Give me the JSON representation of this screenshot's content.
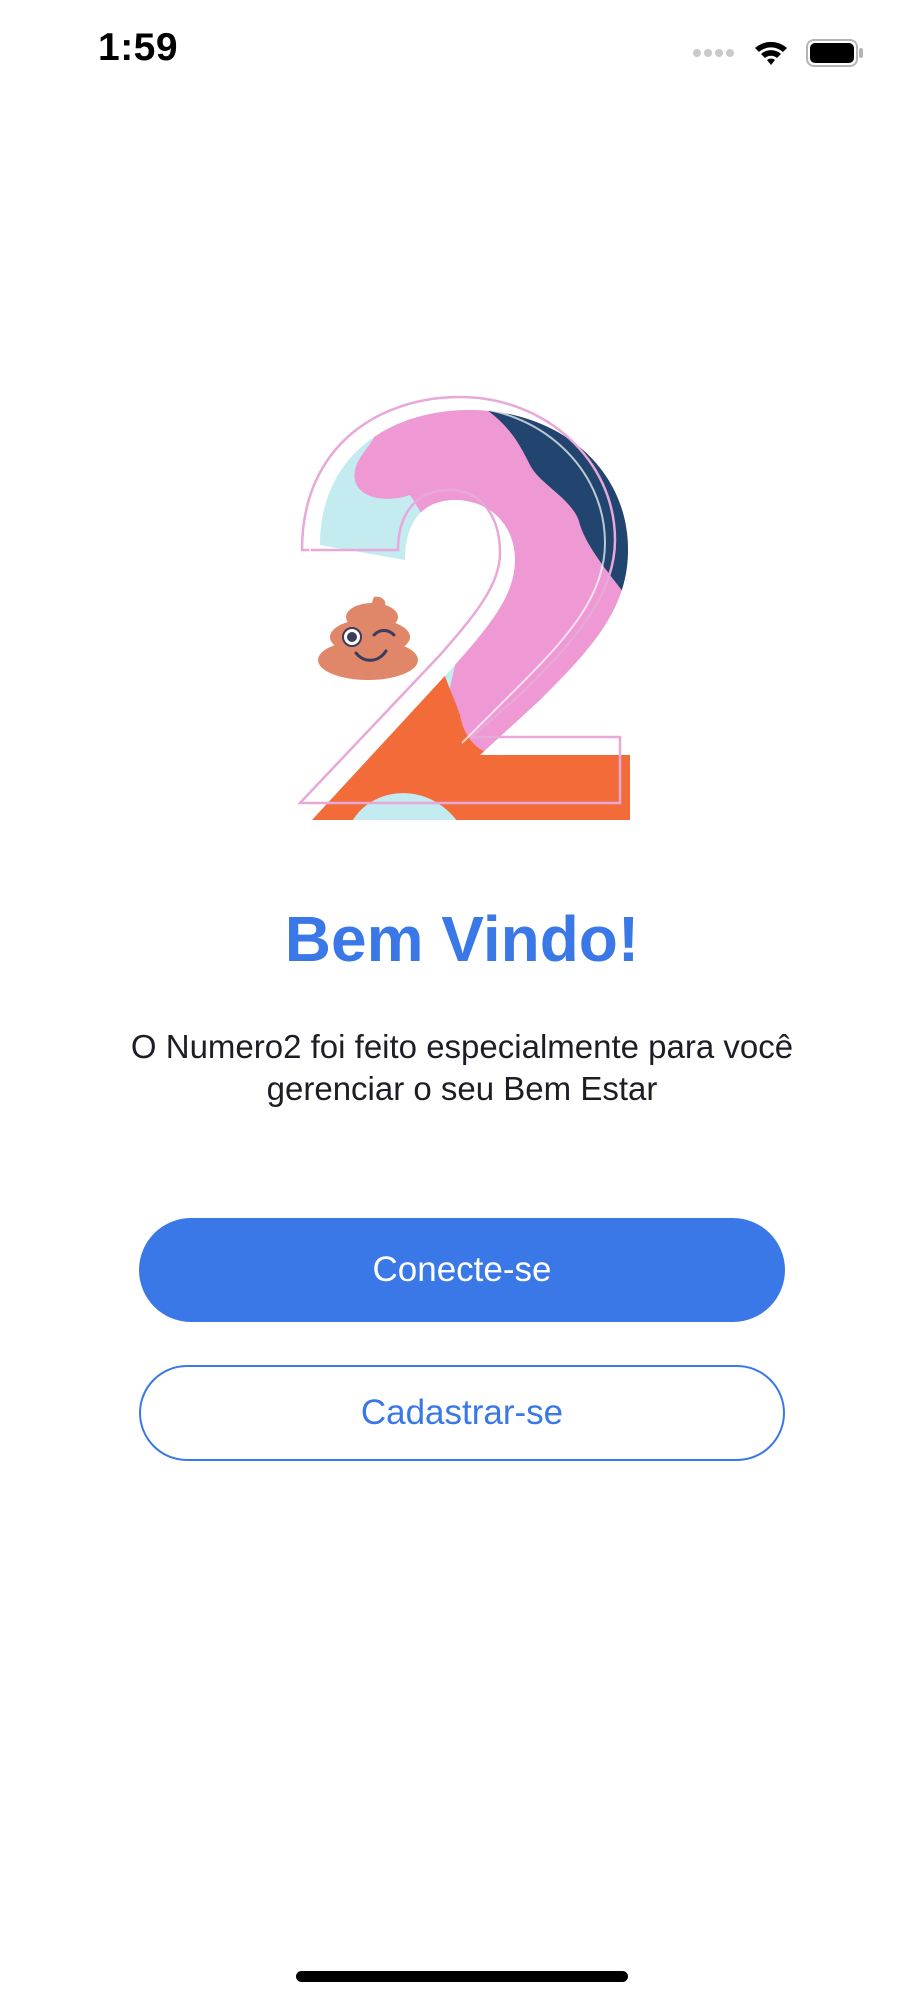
{
  "status_bar": {
    "time": "1:59",
    "icons": [
      "signal-dots-icon",
      "wifi-icon",
      "battery-icon"
    ]
  },
  "hero": {
    "illustration": "number-two-illustration",
    "mascot": "winking-poop-emoji-icon"
  },
  "welcome": {
    "title": "Bem Vindo!",
    "description": "O Numero2 foi feito especialmente para você gerenciar o seu Bem Estar"
  },
  "actions": {
    "login_label": "Conecte-se",
    "signup_label": "Cadastrar-se"
  },
  "colors": {
    "accent": "#3a78e7",
    "text": "#1d1d26",
    "pink": "#ee99d3",
    "navy": "#21456e",
    "orange": "#f26b38",
    "light_blue": "#c4ebf0",
    "poop": "#e0876a"
  }
}
